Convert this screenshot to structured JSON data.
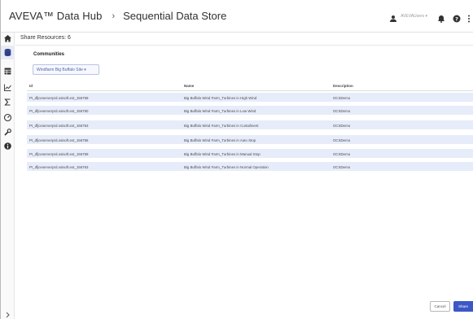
{
  "header": {
    "brand": "AVEVA™ Data Hub",
    "breadcrumb_separator": "›",
    "breadcrumb": "Sequential Data Store",
    "user_name": "AVEVAUsers ▾",
    "icons": [
      "user-icon",
      "bell-icon",
      "help-icon",
      "more-icon"
    ]
  },
  "sidebar": {
    "items": [
      {
        "icon": "home-icon"
      },
      {
        "icon": "database-icon"
      },
      {
        "icon": "table-icon"
      },
      {
        "icon": "chart-icon"
      },
      {
        "icon": "sigma-icon"
      },
      {
        "icon": "gauge-icon"
      },
      {
        "icon": "wrench-icon"
      },
      {
        "icon": "info-icon"
      }
    ],
    "expand_icon": "chevron-right-icon"
  },
  "page": {
    "title": "Share Resources: 6",
    "communities_label": "Communities",
    "community_chip": "Windfarm Big Buffalo Site ▾"
  },
  "table": {
    "columns": [
      "Id",
      "Name",
      "Description"
    ],
    "rows": [
      {
        "id": "PI_dfjceserverprd.osisoft.ext_156769",
        "name": "Big Buffalo Wind Farm_Turbines in High Wind",
        "description": "OCSDemo"
      },
      {
        "id": "PI_dfjceserverprd.osisoft.ext_156750",
        "name": "Big Buffalo Wind Farm_Turbines in Low Wind",
        "description": "OCSDemo"
      },
      {
        "id": "PI_dfjceserverprd.osisoft.ext_156753",
        "name": "Big Buffalo Wind Farm_Turbines in Curtailment",
        "description": "OCSDemo"
      },
      {
        "id": "PI_dfjceserverprd.osisoft.ext_156756",
        "name": "Big Buffalo Wind Farm_Turbines in Auto Stop",
        "description": "OCSDemo"
      },
      {
        "id": "PI_dfjceserverprd.osisoft.ext_156759",
        "name": "Big Buffalo Wind Farm_Turbines in Manual Stop",
        "description": "OCSDemo"
      },
      {
        "id": "PI_dfjceserverprd.osisoft.ext_156763",
        "name": "Big Buffalo Wind Farm_Turbines in Normal Operation",
        "description": "OCSDemo"
      }
    ]
  },
  "footer": {
    "cancel_label": "Cancel",
    "share_label": "Share"
  },
  "colors": {
    "accent": "#3c57c6",
    "row_selected": "#e7ecfa",
    "chip_border": "#b9c4e6"
  }
}
